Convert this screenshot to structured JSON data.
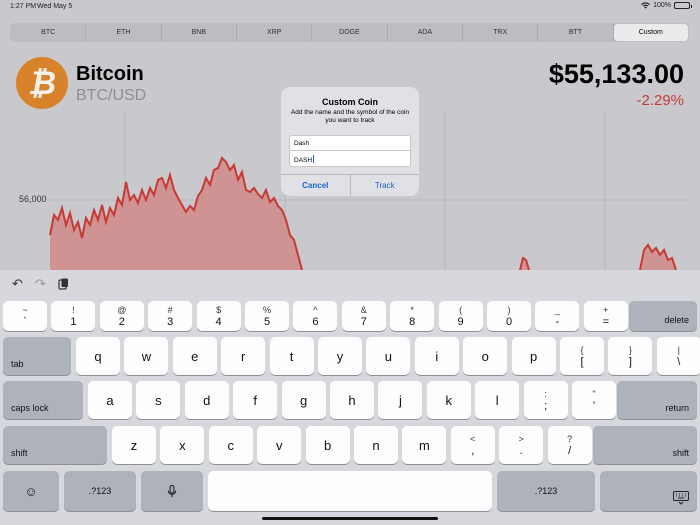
{
  "status": {
    "time": "1:27 PM",
    "date": "Wed May 5",
    "battery": "100%",
    "battery_level": 1.0
  },
  "tabs": [
    "BTC",
    "ETH",
    "BNB",
    "XRP",
    "DOGE",
    "ADA",
    "TRX",
    "BTT",
    "Custom"
  ],
  "selected_tab": "Custom",
  "coin": {
    "symbol_glyph": "₿",
    "name": "Bitcoin",
    "pair": "BTC/USD",
    "price": "$55,133.00",
    "change": "-2.29%",
    "change_color": "#c73a33",
    "logo_color": "#d8832c"
  },
  "chart": {
    "y_label": "56,000",
    "line_color": "#c73a33",
    "fill_color": "#d08a88"
  },
  "dialog": {
    "title": "Custom Coin",
    "message": "Add the name and the symbol of the coin you want to track",
    "name_value": "Dash",
    "symbol_value": "DASH",
    "cancel_label": "Cancel",
    "track_label": "Track",
    "accent_color": "#1a63d6"
  },
  "keyboard": {
    "toolbar": {
      "undo_icon": "undo-icon",
      "redo_icon": "redo-icon",
      "paste_icon": "paste-icon"
    },
    "number_row": [
      {
        "top": "~",
        "bot": "`"
      },
      {
        "top": "!",
        "bot": "1"
      },
      {
        "top": "@",
        "bot": "2"
      },
      {
        "top": "#",
        "bot": "3"
      },
      {
        "top": "$",
        "bot": "4"
      },
      {
        "top": "%",
        "bot": "5"
      },
      {
        "top": "^",
        "bot": "6"
      },
      {
        "top": "&",
        "bot": "7"
      },
      {
        "top": "*",
        "bot": "8"
      },
      {
        "top": "(",
        "bot": "9"
      },
      {
        "top": ")",
        "bot": "0"
      },
      {
        "top": "_",
        "bot": "-"
      },
      {
        "top": "+",
        "bot": "="
      }
    ],
    "delete_label": "delete",
    "tab_label": "tab",
    "row_q": [
      "q",
      "w",
      "e",
      "r",
      "t",
      "y",
      "u",
      "i",
      "o",
      "p"
    ],
    "row_q_extra": [
      {
        "top": "{",
        "bot": "["
      },
      {
        "top": "}",
        "bot": "]"
      },
      {
        "top": "|",
        "bot": "\\"
      }
    ],
    "caps_label": "caps lock",
    "row_a": [
      "a",
      "s",
      "d",
      "f",
      "g",
      "h",
      "j",
      "k",
      "l"
    ],
    "row_a_extra": [
      {
        "top": ":",
        "bot": ";"
      },
      {
        "top": "\"",
        "bot": "'"
      }
    ],
    "return_label": "return",
    "shift_label": "shift",
    "row_z": [
      "z",
      "x",
      "c",
      "v",
      "b",
      "n",
      "m"
    ],
    "row_z_extra": [
      {
        "top": "<",
        "bot": ","
      },
      {
        "top": ">",
        "bot": "."
      },
      {
        "top": "?",
        "bot": "/"
      }
    ],
    "numbers_label": ".?123",
    "emoji_icon": "emoji-icon",
    "mic_icon": "microphone-icon",
    "dismiss_icon": "keyboard-dismiss-icon"
  }
}
